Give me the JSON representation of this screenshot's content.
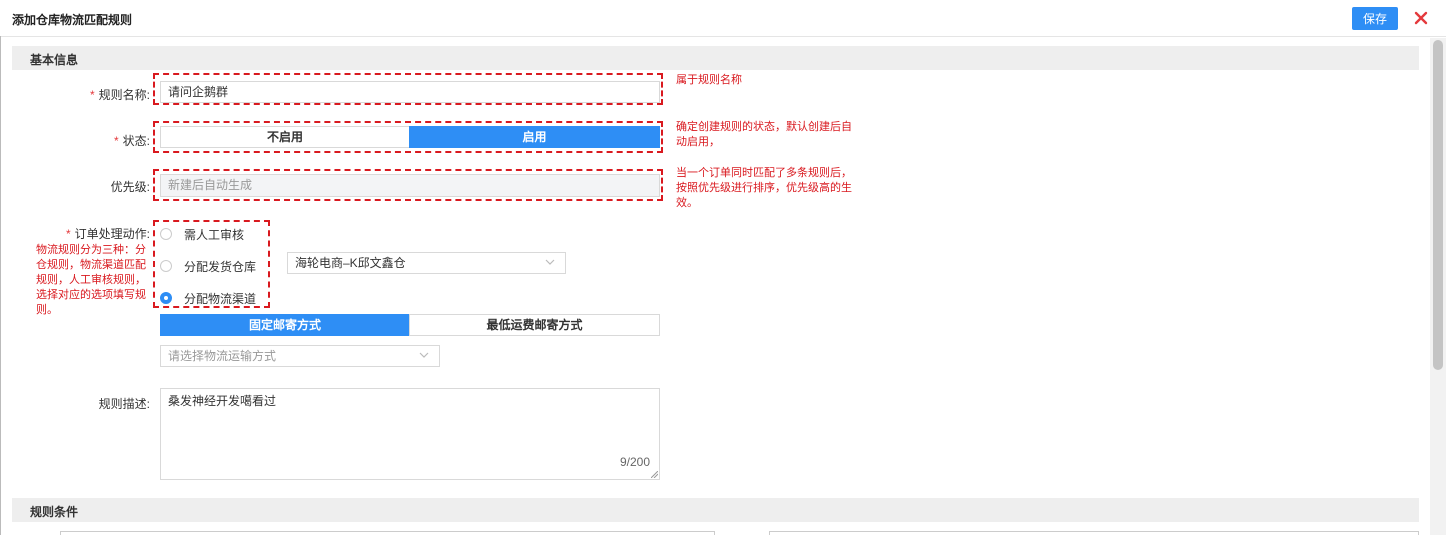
{
  "dialog": {
    "title": "添加仓库物流匹配规则",
    "save_label": "保存",
    "close_icon": "close-icon",
    "accent_color": "#2e8ef5",
    "annotation_color": "#d9191f"
  },
  "sections": {
    "basic": "基本信息",
    "conditions": "规则条件"
  },
  "form": {
    "name": {
      "label": "规则名称:",
      "value": "请问企鹅群"
    },
    "status": {
      "label": "状态:",
      "options": [
        "不启用",
        "启用"
      ],
      "selected": "启用"
    },
    "priority": {
      "label": "优先级:",
      "placeholder": "新建后自动生成"
    },
    "action": {
      "label": "订单处理动作:",
      "options": [
        "需人工审核",
        "分配发货仓库",
        "分配物流渠道"
      ],
      "selected": "分配物流渠道",
      "warehouse_select": "海轮电商–K邱文鑫仓",
      "shipping_modes": [
        "固定邮寄方式",
        "最低运费邮寄方式"
      ],
      "shipping_mode_selected": "固定邮寄方式",
      "transport_placeholder": "请选择物流运输方式"
    },
    "description": {
      "label": "规则描述:",
      "value": "桑发神经开发噶看过",
      "counter": "9/200"
    }
  },
  "annotations": {
    "name": "属于规则名称",
    "status": "确定创建规则的状态，默认创建后自动启用，",
    "priority": "当一个订单同时匹配了多条规则后，按照优先级进行排序，优先级高的生效。",
    "action": "物流规则分为三种：分仓规则，物流渠道匹配规则，人工审核规则，选择对应的选项填写规则。"
  }
}
